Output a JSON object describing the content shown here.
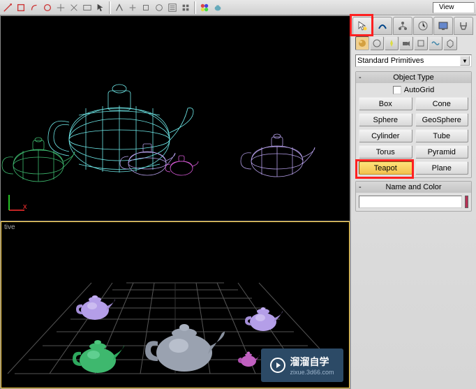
{
  "toolbar": {
    "view_label": "View"
  },
  "viewports": {
    "perspective_label": "tive"
  },
  "cmd_panel": {
    "dropdown_value": "Standard Primitives",
    "rollout_object_type": {
      "title": "Object Type",
      "autogrid_label": "AutoGrid",
      "buttons": [
        "Box",
        "Cone",
        "Sphere",
        "GeoSphere",
        "Cylinder",
        "Tube",
        "Torus",
        "Pyramid",
        "Teapot",
        "Plane"
      ],
      "active_index": 8
    },
    "rollout_name_color": {
      "title": "Name and Color",
      "name_value": "",
      "color": "#b83055"
    }
  },
  "colors": {
    "teapot_cyan": "#6ee8e8",
    "teapot_green": "#3eb86e",
    "teapot_purple": "#b49ee8",
    "teapot_gray": "#9aa2b0"
  },
  "watermark": {
    "main": "溜溜自学",
    "sub": "zixue.3d66.com"
  }
}
